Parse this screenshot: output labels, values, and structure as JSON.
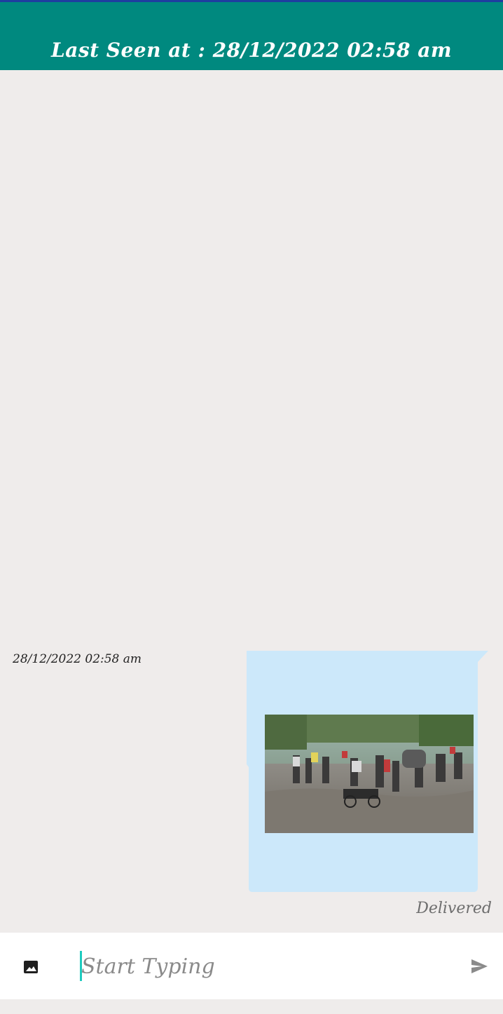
{
  "header": {
    "last_seen": "Last Seen at : 28/12/2022  02:58 am"
  },
  "colors": {
    "header_bg": "#00897f",
    "chat_bg": "#efeceb",
    "bubble_bg": "#cce8fa",
    "caret": "#1ecbbf"
  },
  "messages": [
    {
      "timestamp": "28/12/2022  02:58 am",
      "type": "image",
      "status": "Delivered"
    }
  ],
  "composer": {
    "placeholder": "Start Typing",
    "value": "",
    "image_icon": "image-icon",
    "send_icon": "send-icon"
  }
}
